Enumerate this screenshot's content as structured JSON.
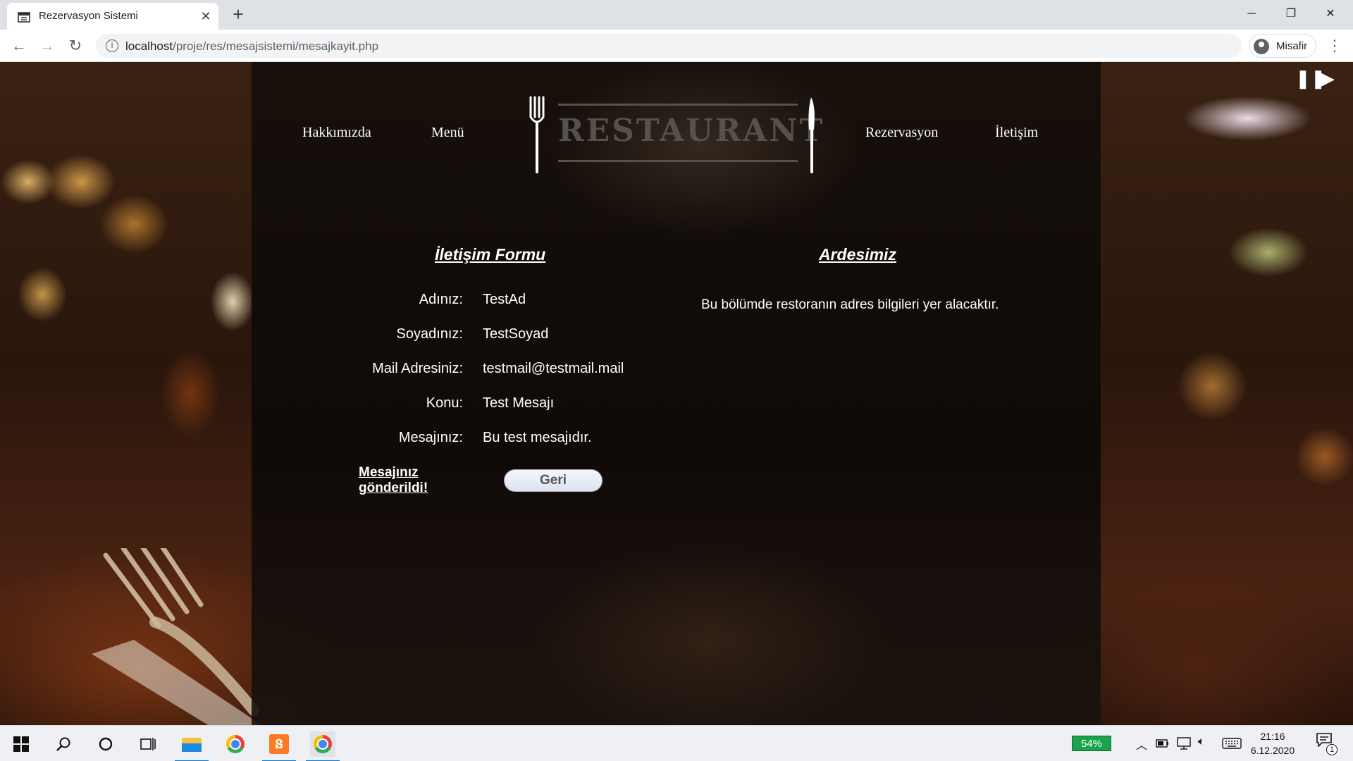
{
  "browser": {
    "tab_title": "Rezervasyon Sistemi",
    "tab_close": "✕",
    "new_tab": "+",
    "url_host": "localhost",
    "url_path": "/proje/res/mesajsistemi/mesajkayit.php",
    "profile_label": "Misafir",
    "window_controls": {
      "minimize": "─",
      "restore": "❐",
      "close": "✕"
    },
    "nav": {
      "back": "←",
      "forward": "→",
      "reload": "↻",
      "info": "i",
      "menu": "⋮"
    }
  },
  "site": {
    "nav_left": [
      "Hakkımızda",
      "Menü"
    ],
    "nav_right": [
      "Rezervasyon",
      "İletişim"
    ],
    "logo_text": "RESTAURANT",
    "slider_controls": {
      "pause": "❚❚",
      "play": "▶"
    }
  },
  "contact_form": {
    "title": "İletişim Formu",
    "fields": [
      {
        "label": "Adınız:",
        "value": "TestAd"
      },
      {
        "label": "Soyadınız:",
        "value": "TestSoyad"
      },
      {
        "label": "Mail Adresiniz:",
        "value": "testmail@testmail.mail"
      },
      {
        "label": "Konu:",
        "value": "Test Mesajı"
      },
      {
        "label": "Mesajınız:",
        "value": "Bu test mesajıdır."
      }
    ],
    "sent_message_line1": "Mesajınız",
    "sent_message_line2": "gönderildi!",
    "back_button": "Geri"
  },
  "address_section": {
    "title": "Ardesimiz",
    "text": "Bu bölümde restoranın adres bilgileri yer alacaktır."
  },
  "taskbar": {
    "battery": "54%",
    "time": "21:16",
    "date": "6.12.2020",
    "notification_count": "1",
    "icons": [
      "windows-start-icon",
      "search-icon",
      "cortana-icon",
      "task-view-icon",
      "file-explorer-icon",
      "chrome-icon",
      "xampp-icon",
      "chrome-icon"
    ]
  },
  "colors": {
    "tabstrip": "#dee1e6",
    "logo_gray": "#55514e",
    "taskbar_accent": "#0078d7",
    "battery_green": "#1aa34a"
  }
}
